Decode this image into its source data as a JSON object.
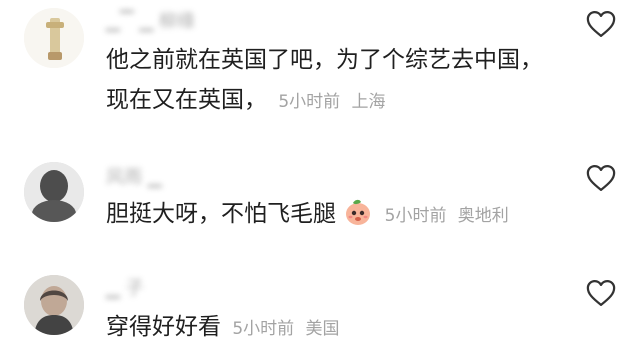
{
  "comments": [
    {
      "username": "▁▔ ▁ 柳缘",
      "text": "他之前就在英国了吧，为了个综艺去中国，现在又在英国，",
      "time": "5小时前",
      "location": "上海"
    },
    {
      "username": "风雨 ▁",
      "text": "胆挺大呀，不怕飞毛腿",
      "time": "5小时前",
      "location": "奥地利"
    },
    {
      "username": "▁ 子",
      "text": "穿得好好看",
      "time": "5小时前",
      "location": "美国"
    }
  ],
  "icons": {
    "like": "heart-outline-icon",
    "sticker": "peach-emoji-icon"
  }
}
